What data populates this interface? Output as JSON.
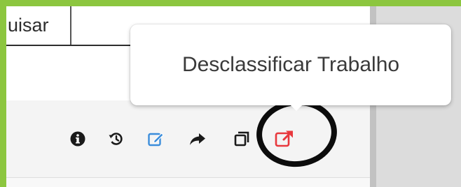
{
  "search": {
    "label": "uisar"
  },
  "tooltip": {
    "text": "Desclassificar Trabalho"
  },
  "actions": [
    {
      "icon": "info-circle-icon",
      "color": "#1a1a1a"
    },
    {
      "icon": "history-icon",
      "color": "#1a1a1a"
    },
    {
      "icon": "edit-icon",
      "color": "#3b8ddb"
    },
    {
      "icon": "share-arrow-icon",
      "color": "#1a1a1a"
    },
    {
      "icon": "copy-icon",
      "color": "#1a1a1a"
    },
    {
      "icon": "external-link-icon",
      "color": "#e8383d"
    }
  ],
  "colors": {
    "accent_green": "#8cc63f",
    "edit_blue": "#3b8ddb",
    "danger_red": "#e8383d",
    "annotation": "#0c0c0c"
  }
}
